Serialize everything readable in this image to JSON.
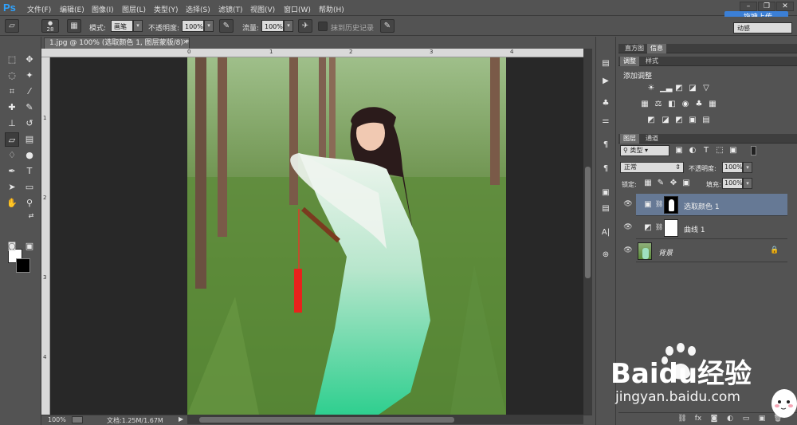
{
  "app": {
    "logo": "Ps"
  },
  "menu": [
    "文件(F)",
    "编辑(E)",
    "图像(I)",
    "图层(L)",
    "类型(Y)",
    "选择(S)",
    "滤镜(T)",
    "视图(V)",
    "窗口(W)",
    "帮助(H)"
  ],
  "upload_button": "拖拽上传",
  "workspace": "动感",
  "options": {
    "brush_size": "28",
    "mode_label": "模式:",
    "mode_value": "画笔",
    "opacity_label": "不透明度:",
    "opacity_value": "100%",
    "flow_label": "流量:",
    "flow_value": "100%",
    "erase_history_label": "抹到历史记录"
  },
  "document": {
    "tab_title": "1.jpg @ 100% (选取颜色 1, 图层蒙版/8) *",
    "ruler_top_marks": [
      "0",
      "1",
      "2",
      "3",
      "4"
    ],
    "ruler_left_marks": [
      "1",
      "2",
      "3",
      "4"
    ],
    "zoom": "100%",
    "doc_info": "文档:1.25M/1.67M"
  },
  "panels": {
    "top_tabs": [
      "直方图",
      "信息"
    ],
    "adjust_tabs": [
      "调整",
      "样式"
    ],
    "add_adjustment": "添加调整",
    "layer_tabs": [
      "图层",
      "通道"
    ],
    "filter_kind": "类型",
    "blend_mode": "正常",
    "opacity_label": "不透明度:",
    "opacity_value": "100%",
    "lock_label": "锁定:",
    "fill_label": "填充:",
    "fill_value": "100%",
    "layers": [
      {
        "name": "选取颜色 1",
        "selected": true
      },
      {
        "name": "曲线 1",
        "selected": false
      },
      {
        "name": "背景",
        "selected": false
      }
    ]
  },
  "watermark": {
    "brand": "Baidu经验",
    "url": "jingyan.baidu.com"
  }
}
